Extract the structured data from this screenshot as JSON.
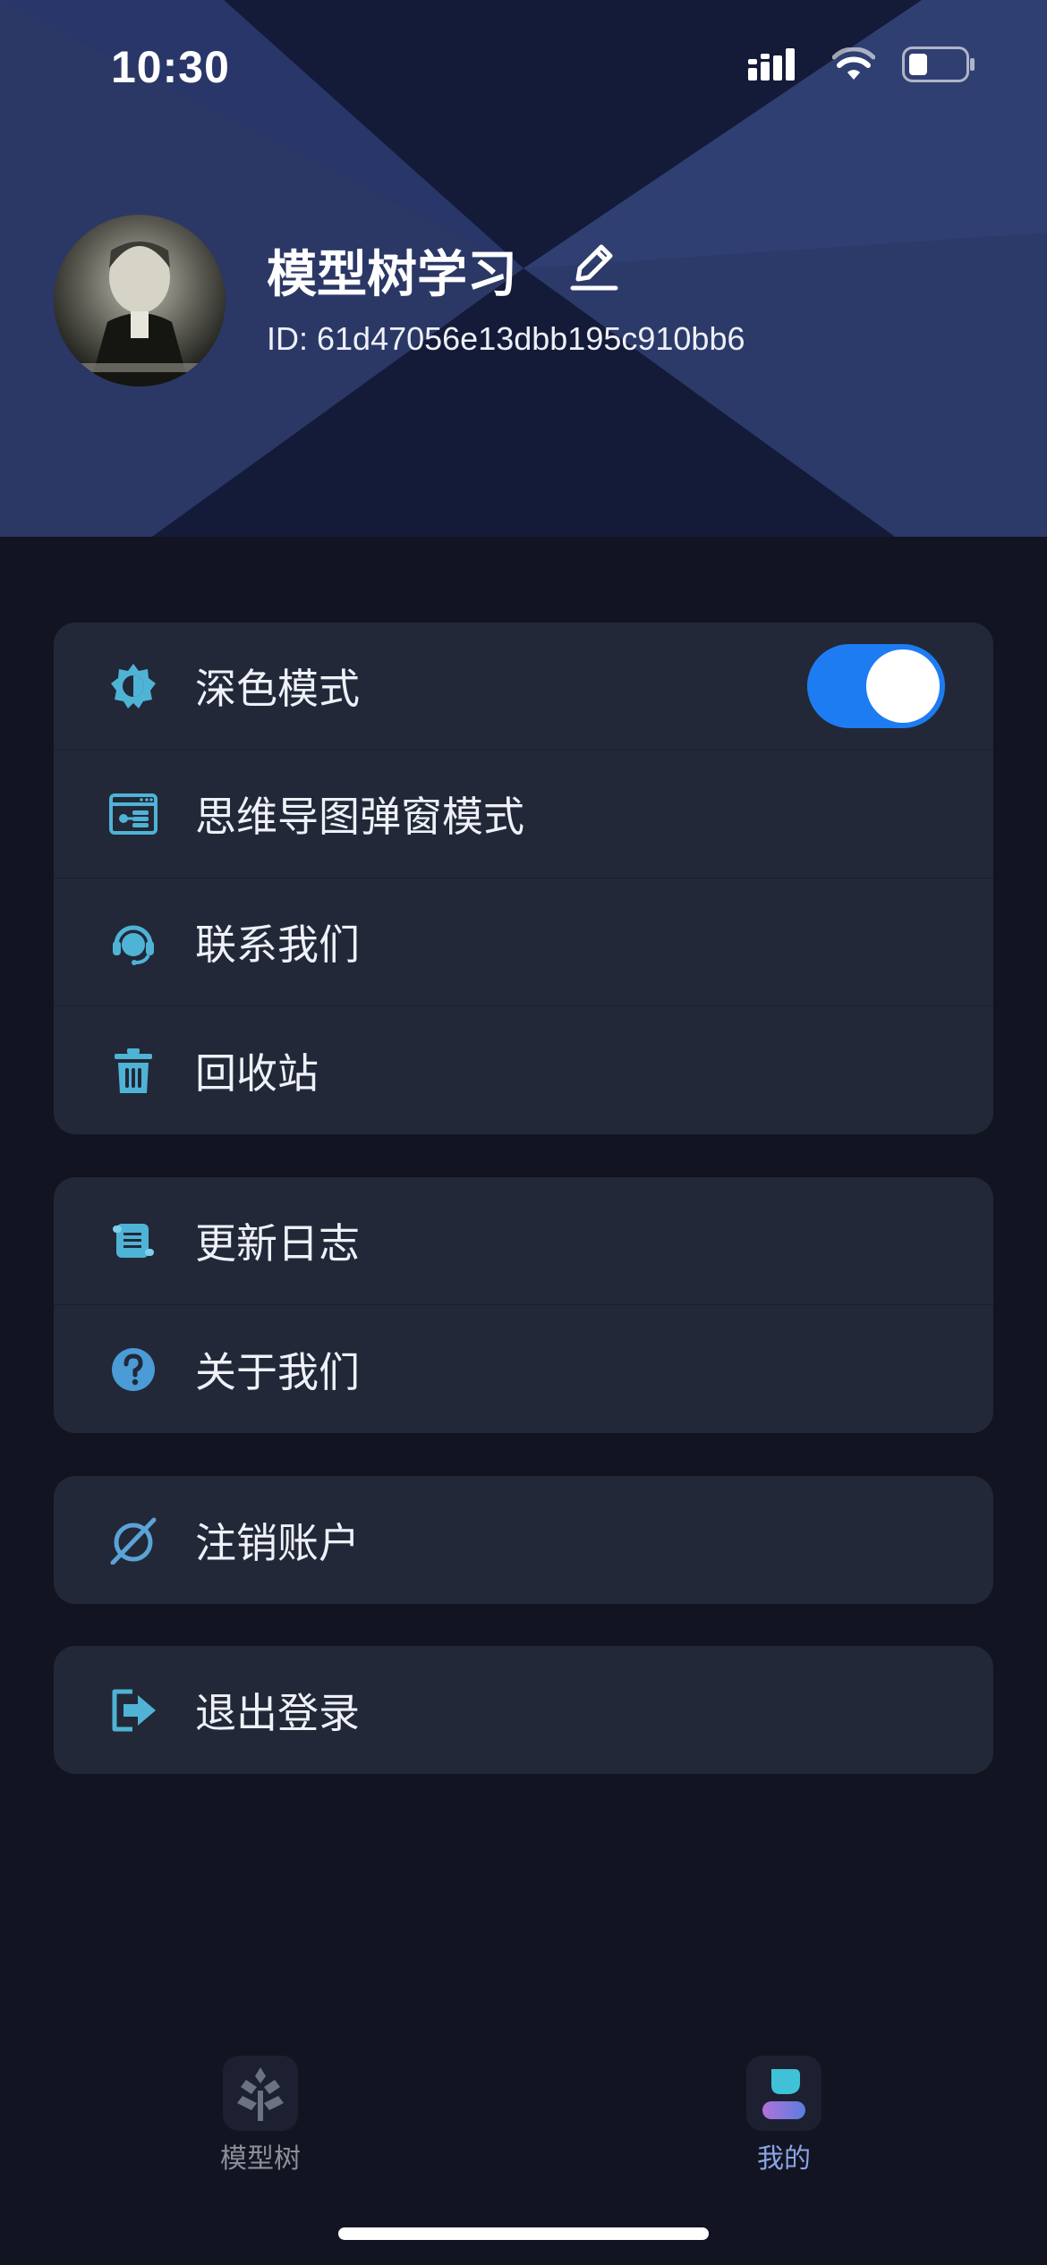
{
  "status_bar": {
    "time": "10:30"
  },
  "profile": {
    "name": "模型树学习",
    "id_text": "ID: 61d47056e13dbb195c910bb6"
  },
  "menu": {
    "dark_mode": {
      "label": "深色模式",
      "icon": "dark-mode-icon",
      "toggle_on": true
    },
    "mindmap_popup": {
      "label": "思维导图弹窗模式",
      "icon": "window-list-icon"
    },
    "contact_us": {
      "label": "联系我们",
      "icon": "headset-icon"
    },
    "recycle_bin": {
      "label": "回收站",
      "icon": "trash-icon"
    },
    "changelog": {
      "label": "更新日志",
      "icon": "scroll-icon"
    },
    "about_us": {
      "label": "关于我们",
      "icon": "question-icon"
    },
    "delete_account": {
      "label": "注销账户",
      "icon": "prohibit-icon"
    },
    "logout": {
      "label": "退出登录",
      "icon": "logout-icon"
    }
  },
  "tabbar": {
    "tabs": [
      {
        "label": "模型树",
        "icon": "tree-icon",
        "active": false
      },
      {
        "label": "我的",
        "icon": "person-icon",
        "active": true
      }
    ]
  },
  "colors": {
    "accent": "#1d7cf2",
    "icon": "#4fb3d6",
    "card": "#222837",
    "background": "#121521",
    "active_tab": "#8aa3e6",
    "inactive_tab": "#8a8f9a"
  }
}
